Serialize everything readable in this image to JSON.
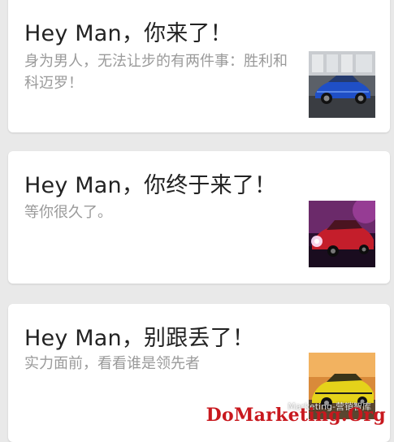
{
  "feed": {
    "cards": [
      {
        "title": "Hey Man，你来了！",
        "body": "身为男人，无法让步的有两件事：胜利和科迈罗！",
        "thumbnail": "blue-sports-car-in-garage"
      },
      {
        "title": "Hey Man，你终于来了！",
        "body": "等你很久了。",
        "thumbnail": "red-sports-car-with-headlights"
      },
      {
        "title": "Hey Man，别跟丢了！",
        "body": "实力面前，看看谁是领先者",
        "thumbnail": "yellow-sports-car-at-sunset"
      }
    ]
  },
  "watermark": {
    "text": "DoMarketing.Org",
    "sub": "Marketing-营销智库"
  },
  "colors": {
    "background": "#e9e9e9",
    "card": "#ffffff",
    "title": "#222222",
    "body": "#9a9a9a",
    "watermark": "#c8181e"
  }
}
